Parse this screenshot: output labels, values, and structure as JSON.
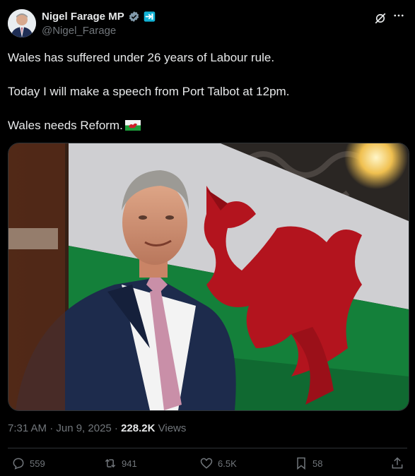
{
  "author": {
    "name": "Nigel Farage MP",
    "handle": "@Nigel_Farage",
    "verified_color": "#1d9bf0"
  },
  "tweet": {
    "line1": "Wales has suffered under 26 years of Labour rule.",
    "line2": "Today I will make a speech from Port Talbot at 12pm.",
    "line3": "Wales needs Reform.",
    "emoji": "welsh-flag-emoji"
  },
  "meta": {
    "timestamp": "7:31 AM · Jun 9, 2025 · ",
    "views_count": "228.2K",
    "views_label": " Views"
  },
  "actions": {
    "replies": "559",
    "reposts": "941",
    "likes": "6.5K",
    "bookmarks": "58"
  },
  "icons": [
    "verified-badge-icon",
    "affiliate-badge-icon",
    "grok-icon",
    "more-icon",
    "reply-icon",
    "repost-icon",
    "like-icon",
    "bookmark-icon",
    "share-icon"
  ],
  "colors": {
    "background": "#000000",
    "text": "#e7e9ea",
    "muted": "#71767b",
    "border": "#2f3336"
  }
}
